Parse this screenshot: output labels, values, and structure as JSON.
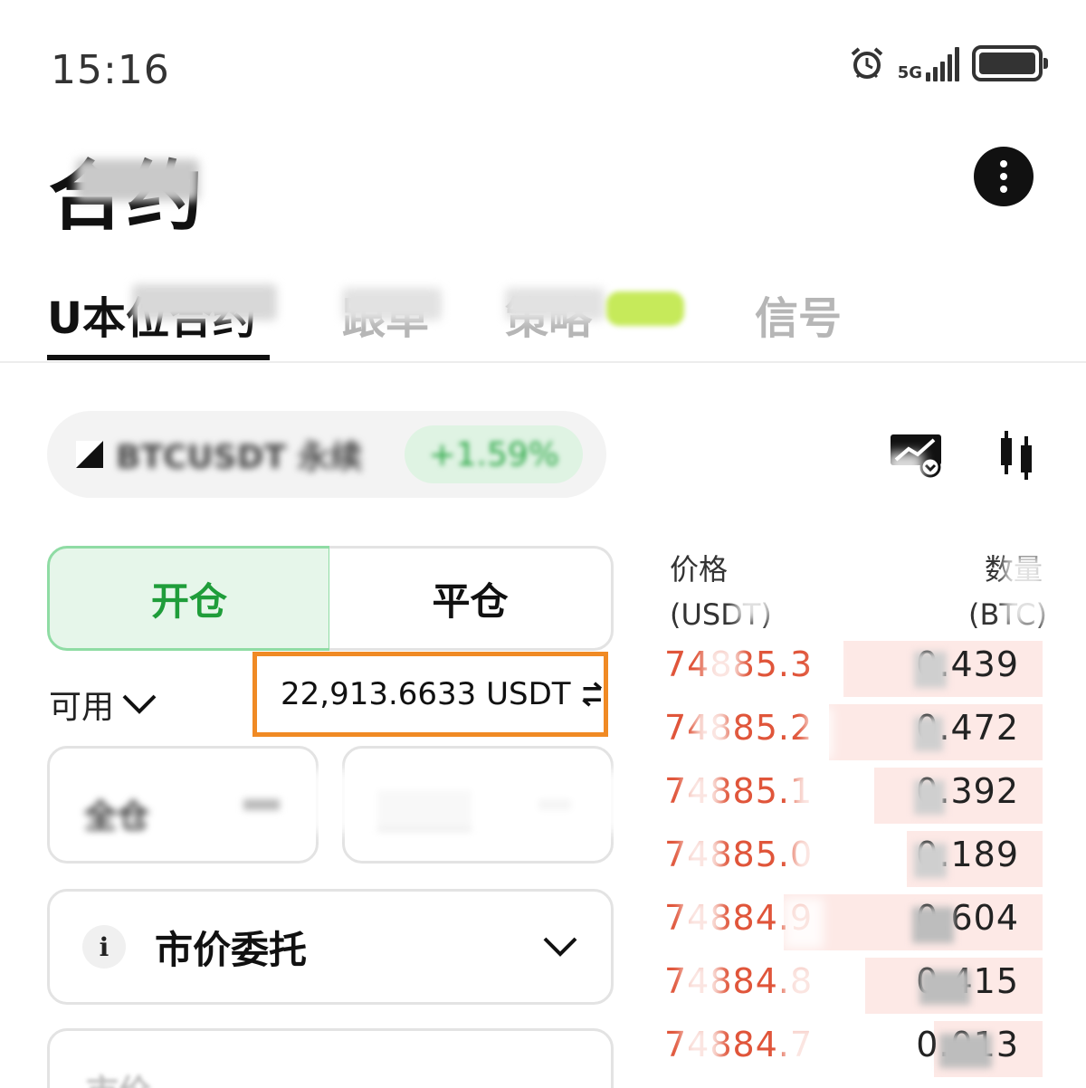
{
  "status_bar": {
    "time": "15:16",
    "network": "5G",
    "icons": [
      "alarm-icon",
      "signal-icon",
      "battery-icon"
    ]
  },
  "header": {
    "title": "合约"
  },
  "tabs": [
    {
      "label": "U本位合约",
      "active": true
    },
    {
      "label": "跟单",
      "active": false
    },
    {
      "label": "策略",
      "active": false
    },
    {
      "label": "信号",
      "active": false
    }
  ],
  "symbol": {
    "name": "BTCUSDT 永续",
    "change": "+1.59%"
  },
  "trade": {
    "open_label": "开仓",
    "close_label": "平仓",
    "available_label": "可用",
    "available_value": "22,913.6633 USDT",
    "margin_mode": "全仓",
    "order_type": "市价委托",
    "price_label": "市价"
  },
  "orderbook": {
    "price_header": "价格",
    "price_unit": "(USDT)",
    "qty_header": "数量",
    "qty_unit": "(BTC)",
    "asks": [
      {
        "price": "74885.3",
        "qty": "0.439"
      },
      {
        "price": "74885.2",
        "qty": "0.472"
      },
      {
        "price": "74885.1",
        "qty": "0.392"
      },
      {
        "price": "74885.0",
        "qty": "0.189"
      },
      {
        "price": "74884.9",
        "qty": "0.604"
      },
      {
        "price": "74884.8",
        "qty": "0.415"
      },
      {
        "price": "74884.7",
        "qty": "0.013"
      }
    ]
  },
  "colors": {
    "ask": "#e0553a",
    "open_green": "#1f9d3a",
    "highlight_orange": "#f08a24"
  }
}
